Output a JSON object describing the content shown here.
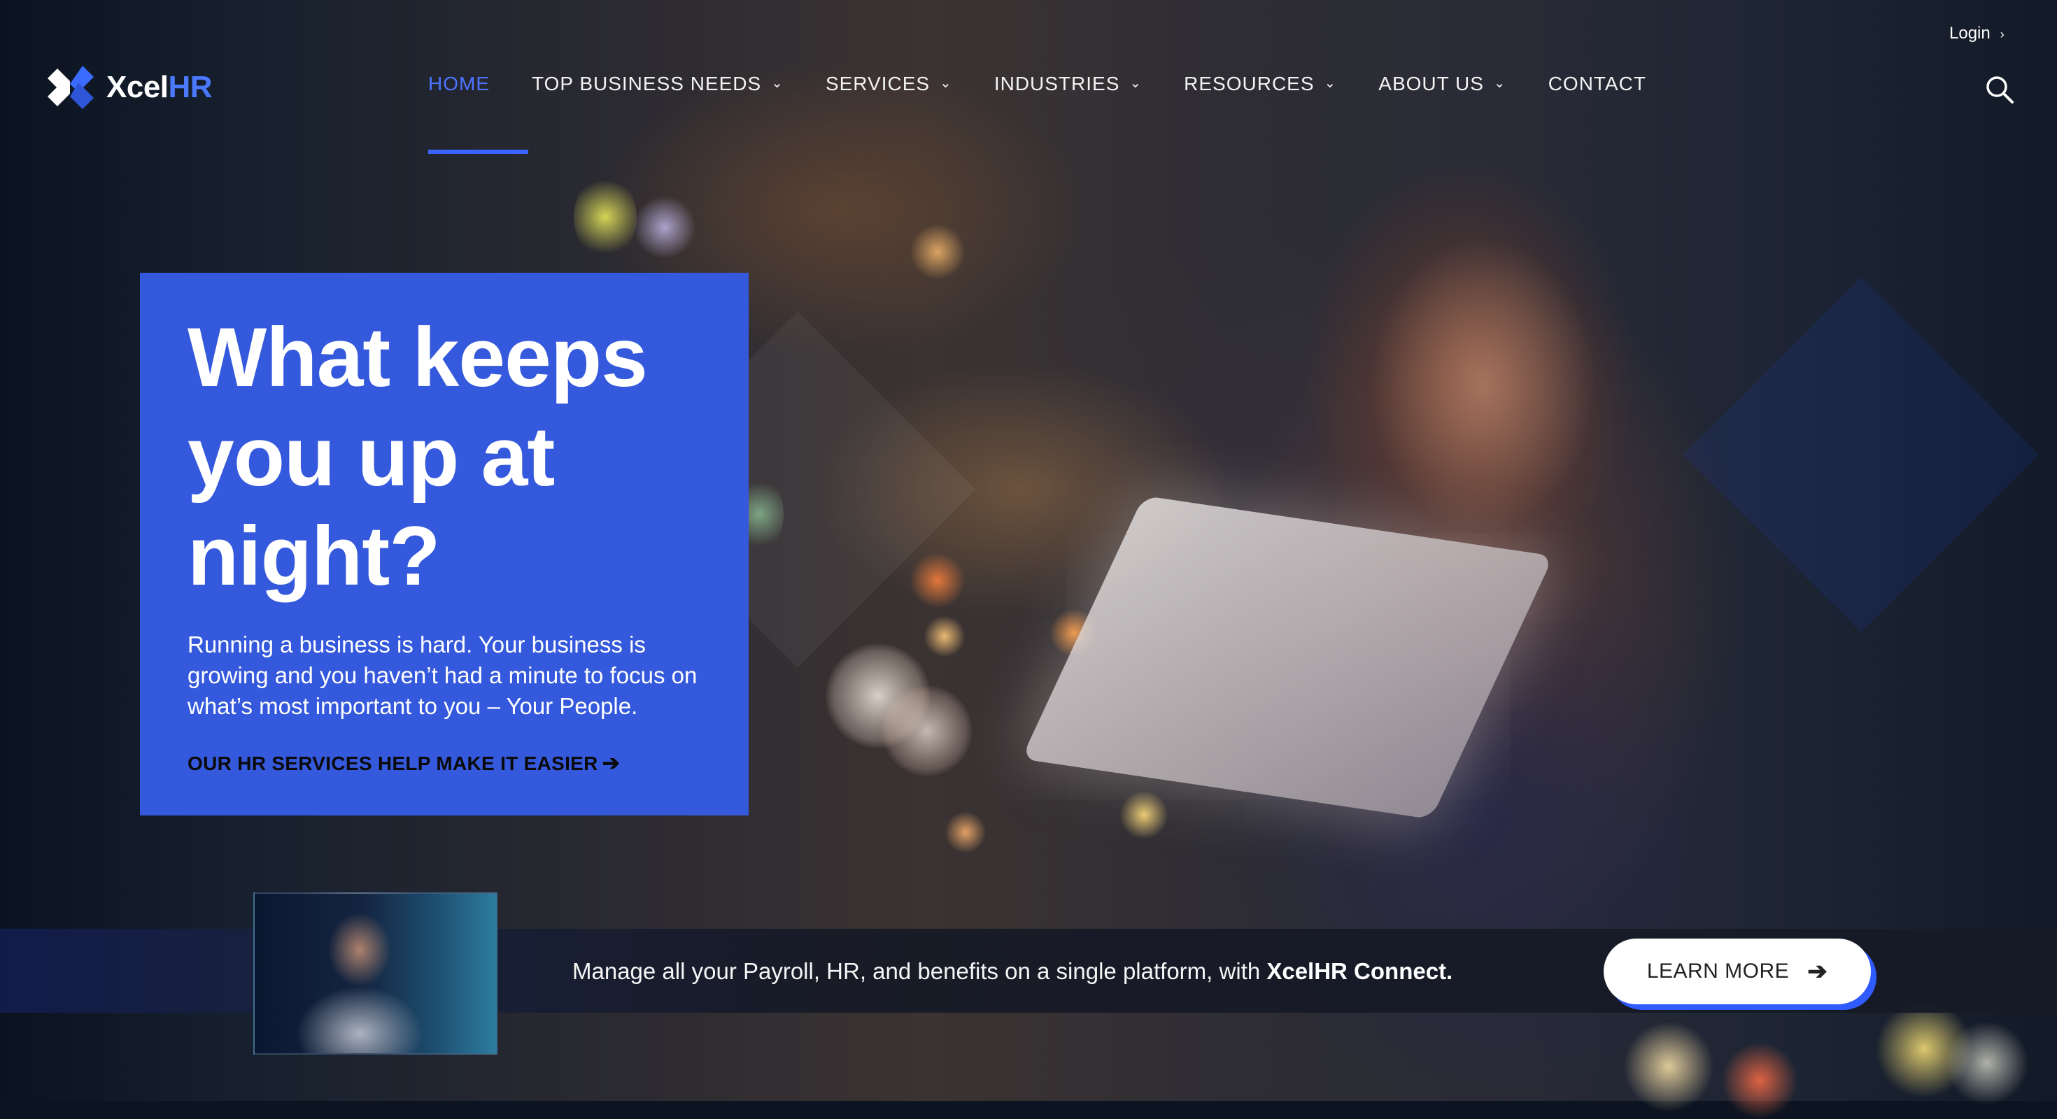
{
  "brand": {
    "name_part1": "Xcel",
    "name_part2": "HR",
    "accent": "#4a78ff"
  },
  "header": {
    "login_label": "Login",
    "nav": [
      {
        "label": "HOME",
        "active": true
      },
      {
        "label": "TOP BUSINESS NEEDS",
        "dropdown": true
      },
      {
        "label": "SERVICES",
        "dropdown": true
      },
      {
        "label": "INDUSTRIES",
        "dropdown": true
      },
      {
        "label": "RESOURCES",
        "dropdown": true
      },
      {
        "label": "ABOUT US",
        "dropdown": true
      },
      {
        "label": "CONTACT"
      }
    ],
    "icons": {
      "search": "search-icon",
      "dropdown": "chevron-down-icon",
      "login": "chevron-right-icon"
    }
  },
  "hero": {
    "title": "What keeps you up at night?",
    "text": "Running a business is hard. Your business is growing and you haven’t had a minute to focus on what’s most important to you – Your People.",
    "link_label": "OUR HR SERVICES HELP MAKE IT EASIER",
    "card_color": "#3559dc"
  },
  "banner": {
    "text_plain": "Manage all your Payroll, HR, and benefits on a single platform, with ",
    "text_bold": "XcelHR Connect.",
    "button_label": "LEARN MORE"
  }
}
